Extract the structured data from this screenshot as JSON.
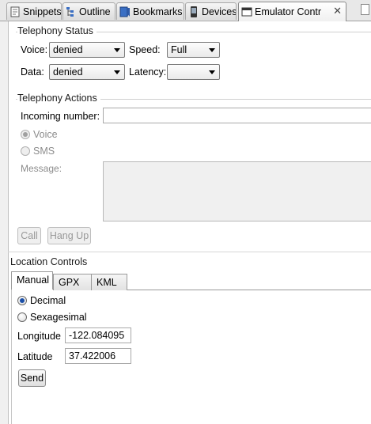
{
  "tabs": [
    {
      "label": "Snippets",
      "icon": "snippets-icon"
    },
    {
      "label": "Outline",
      "icon": "outline-icon"
    },
    {
      "label": "Bookmarks",
      "icon": "bookmarks-icon"
    },
    {
      "label": "Devices",
      "icon": "devices-phone-icon"
    },
    {
      "label": "Emulator Contr",
      "icon": "emulator-control-icon",
      "active": true
    }
  ],
  "telephony_status": {
    "title": "Telephony Status",
    "voice_label": "Voice:",
    "voice_value": "denied",
    "speed_label": "Speed:",
    "speed_value": "Full",
    "data_label": "Data:",
    "data_value": "denied",
    "latency_label": "Latency:",
    "latency_value": ""
  },
  "telephony_actions": {
    "title": "Telephony Actions",
    "incoming_label": "Incoming number:",
    "incoming_value": "",
    "voice_label": "Voice",
    "sms_label": "SMS",
    "message_label": "Message:",
    "call_label": "Call",
    "hangup_label": "Hang Up"
  },
  "location": {
    "title": "Location Controls",
    "tabs": [
      "Manual",
      "GPX",
      "KML"
    ],
    "decimal_label": "Decimal",
    "sexagesimal_label": "Sexagesimal",
    "longitude_label": "Longitude",
    "longitude_value": "-122.084095",
    "latitude_label": "Latitude",
    "latitude_value": "37.422006",
    "send_label": "Send"
  },
  "colors": {
    "accent": "#1a4fa8"
  }
}
